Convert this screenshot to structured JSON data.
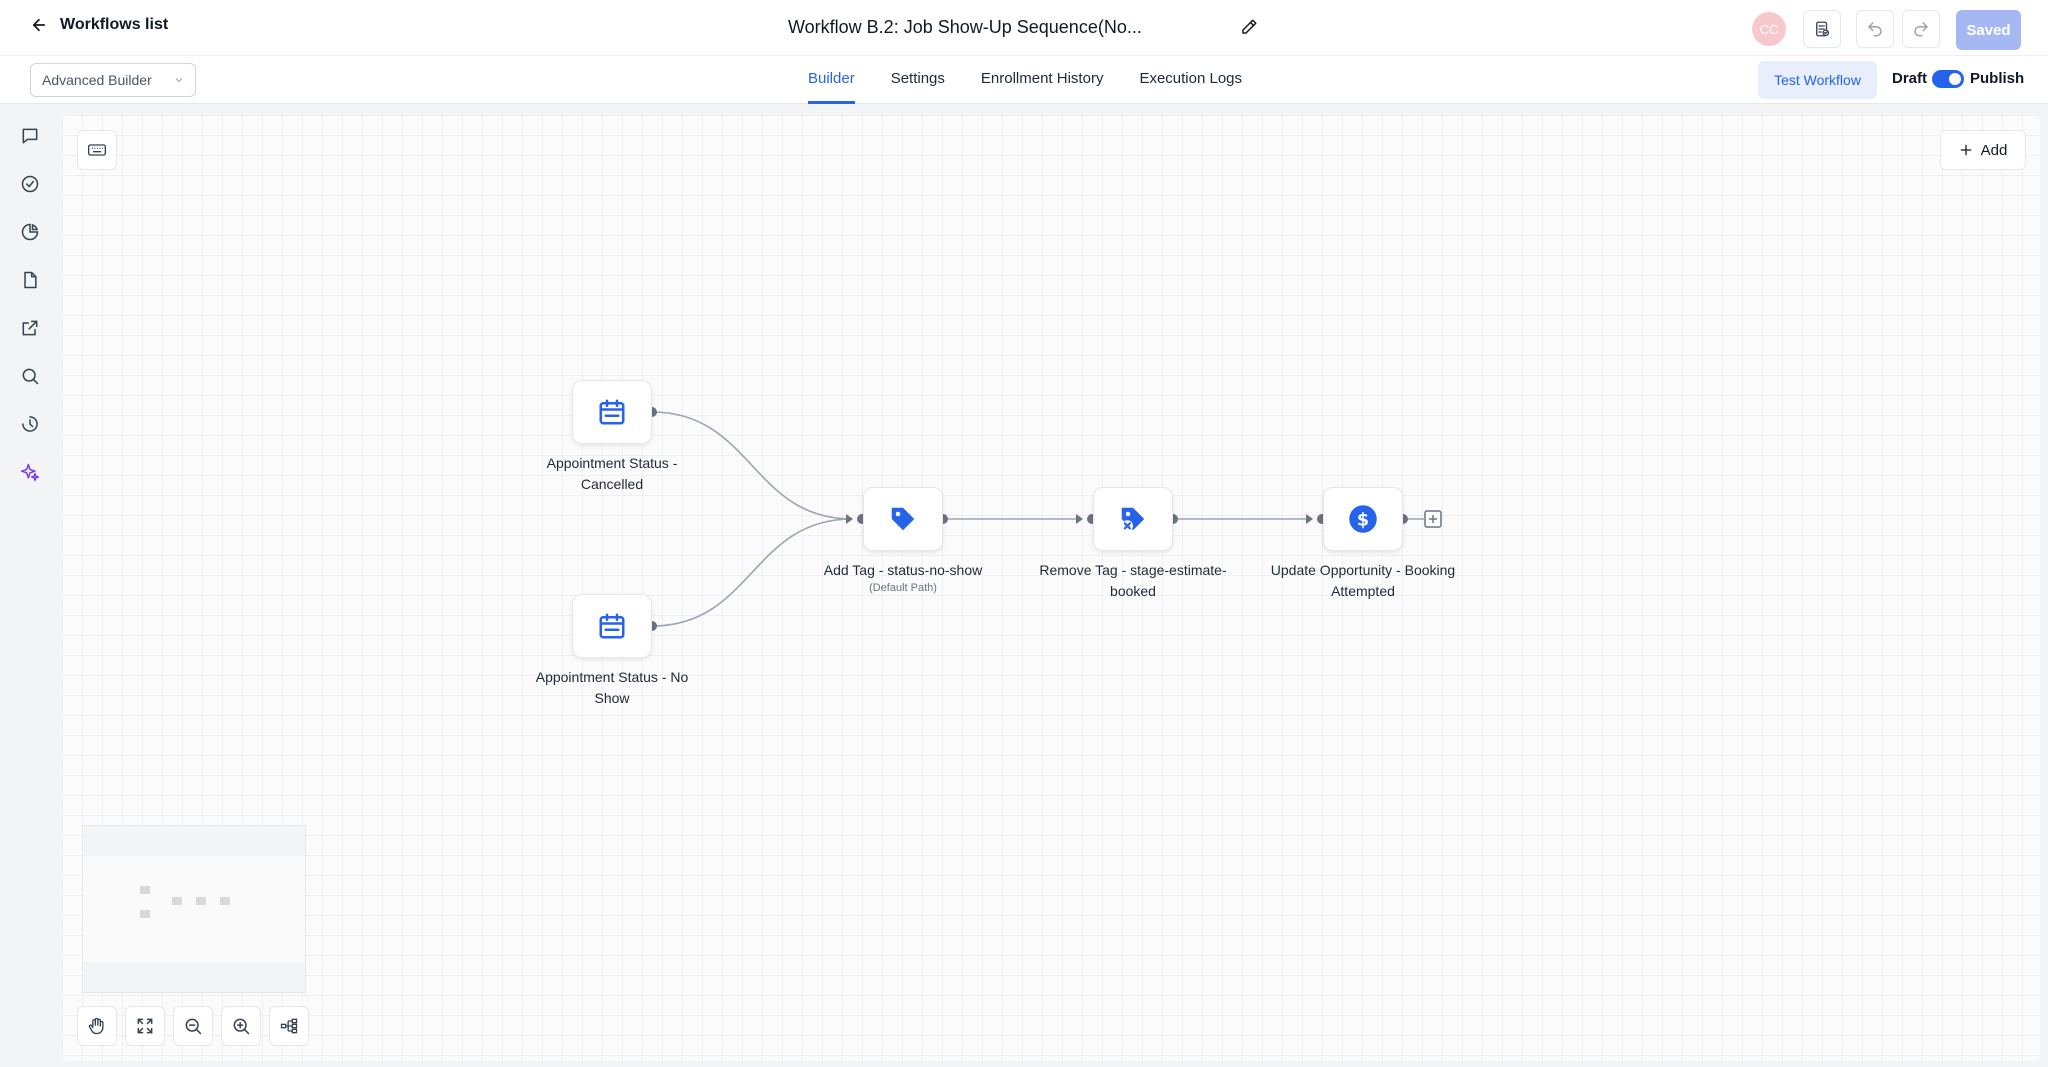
{
  "header": {
    "back_label": "Workflows list",
    "workflow_title": "Workflow B.2: Job Show-Up Sequence(No...",
    "avatar_initials": "CC",
    "saved_label": "Saved"
  },
  "subbar": {
    "builder_mode": "Advanced Builder",
    "tabs": [
      {
        "label": "Builder",
        "active": true
      },
      {
        "label": "Settings",
        "active": false
      },
      {
        "label": "Enrollment History",
        "active": false
      },
      {
        "label": "Execution Logs",
        "active": false
      }
    ],
    "test_workflow_label": "Test Workflow",
    "draft_label": "Draft",
    "publish_label": "Publish",
    "publish_toggle_on": true
  },
  "sidebar": {
    "icons": [
      "chat-icon",
      "check-circle-icon",
      "pie-chart-icon",
      "file-icon",
      "external-link-icon",
      "search-icon",
      "history-icon",
      "sparkles-icon"
    ]
  },
  "canvas": {
    "add_label": "Add",
    "nodes": [
      {
        "id": "trigger-cancelled",
        "type": "trigger",
        "icon": "calendar-icon",
        "label": "Appointment Status - Cancelled"
      },
      {
        "id": "trigger-no-show",
        "type": "trigger",
        "icon": "calendar-icon",
        "label": "Appointment Status - No Show"
      },
      {
        "id": "add-tag",
        "type": "action",
        "icon": "tag-icon",
        "label": "Add Tag - status-no-show",
        "sublabel": "(Default Path)"
      },
      {
        "id": "remove-tag",
        "type": "action",
        "icon": "tag-remove-icon",
        "label": "Remove Tag - stage-estimate-booked"
      },
      {
        "id": "update-opportunity",
        "type": "action",
        "icon": "dollar-icon",
        "label": "Update Opportunity - Booking Attempted"
      }
    ]
  },
  "colors": {
    "accent": "#2563eb",
    "saved_button": "#a5b8f3",
    "avatar": "#f8c9cc",
    "sparkles": "#7c3aed"
  }
}
